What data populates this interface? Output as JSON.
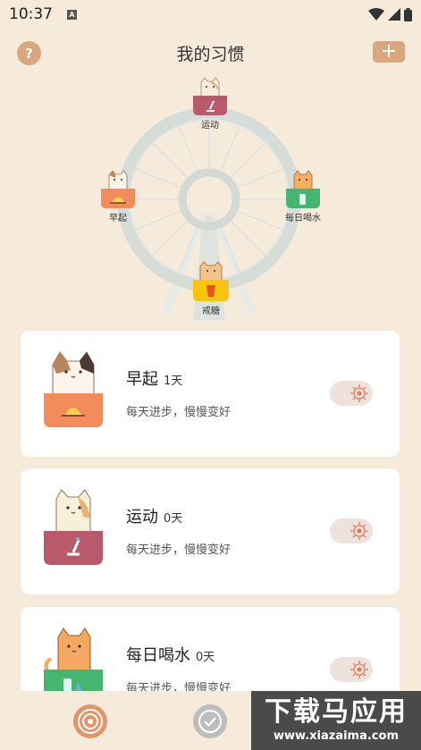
{
  "status_bar": {
    "time": "10:37",
    "notification_icon": "A"
  },
  "header": {
    "title": "我的习惯",
    "help_label": "?",
    "add_label": "+"
  },
  "wheel": {
    "nodes": [
      {
        "label": "运动",
        "color": "#b95a6c",
        "icon": "microscope-icon"
      },
      {
        "label": "每日喝水",
        "color": "#45b56f",
        "icon": "water-bottle-icon"
      },
      {
        "label": "戒糖",
        "color": "#f7c510",
        "icon": "cup-icon"
      },
      {
        "label": "早起",
        "color": "#f48b5a",
        "icon": "sunrise-icon"
      }
    ]
  },
  "habits": [
    {
      "name": "早起",
      "days": "1天",
      "motto": "每天进步，慢慢变好",
      "color": "#f48b5a",
      "cat": "calico"
    },
    {
      "name": "运动",
      "days": "0天",
      "motto": "每天进步，慢慢变好",
      "color": "#b95a6c",
      "cat": "cream"
    },
    {
      "name": "每日喝水",
      "days": "0天",
      "motto": "每天进步，慢慢变好",
      "color": "#45b56f",
      "cat": "orange"
    }
  ],
  "bottom_nav": {
    "active_tab": "habits"
  },
  "watermark": {
    "main": "下载马应用",
    "sub": "www.xiazaima.com"
  },
  "colors": {
    "background": "#f6eadb",
    "accent": "#d8a77f",
    "card": "#ffffff"
  }
}
